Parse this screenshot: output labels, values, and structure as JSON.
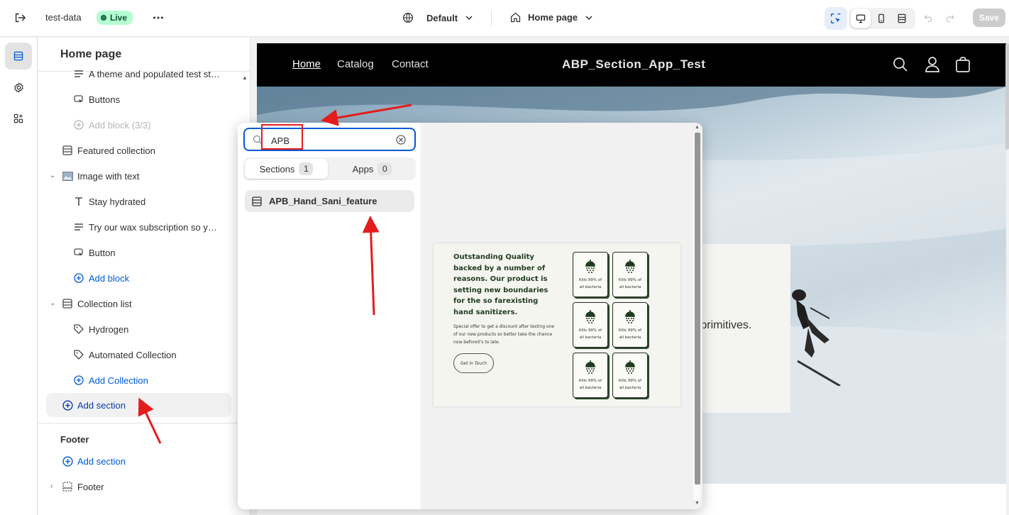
{
  "topbar": {
    "store_name": "test-data",
    "status": "Live",
    "theme": "Default",
    "page": "Home page",
    "save": "Save"
  },
  "sidebar": {
    "title": "Home page",
    "rows": [
      {
        "label": "A theme and populated test st…",
        "icon": "text-lines-icon"
      },
      {
        "label": "Buttons",
        "icon": "button-icon"
      },
      {
        "label": "Add block (3/3)",
        "icon": "plus-circle-icon"
      },
      {
        "label": "Featured collection",
        "icon": "section-icon"
      },
      {
        "label": "Image with text",
        "icon": "image-icon"
      },
      {
        "label": "Stay hydrated",
        "icon": "heading-icon"
      },
      {
        "label": "Try our wax subscription so y…",
        "icon": "text-lines-icon"
      },
      {
        "label": "Button",
        "icon": "button-icon"
      },
      {
        "label": "Add block",
        "icon": "plus-circle-icon"
      },
      {
        "label": "Collection list",
        "icon": "section-icon"
      },
      {
        "label": "Hydrogen",
        "icon": "tag-icon"
      },
      {
        "label": "Automated Collection",
        "icon": "tag-icon"
      },
      {
        "label": "Add Collection",
        "icon": "plus-circle-icon"
      },
      {
        "label": "Add section",
        "icon": "plus-circle-icon"
      }
    ],
    "footer_group": "Footer",
    "footer_add_section": "Add section",
    "footer_item": "Footer"
  },
  "store": {
    "nav": [
      "Home",
      "Catalog",
      "Contact"
    ],
    "brand": "ABP_Section_App_Test",
    "hero_text": "e primitives."
  },
  "picker": {
    "search_value": "APB",
    "tabs": [
      {
        "label": "Sections",
        "count": "1"
      },
      {
        "label": "Apps",
        "count": "0"
      }
    ],
    "result": "APB_Hand_Sani_feature",
    "preview": {
      "heading": "Outstanding Quality backed by a number of reasons. Our product is setting new boundaries for the so farexisting hand sanitizers.",
      "body": "Special offer to get a discount after testing one of our new products so better take the chance now beforeit's to late.",
      "button": "Get in Touch",
      "tile_text": "Kills 99% of all bacteria"
    }
  },
  "colors": {
    "accent": "#005bd3",
    "live_badge": "#b4fed2",
    "annotation": "#e51c1c"
  }
}
